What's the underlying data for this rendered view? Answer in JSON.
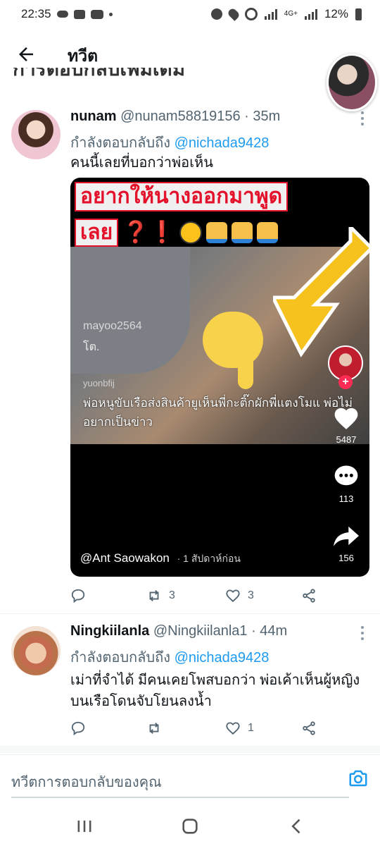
{
  "status_bar": {
    "time": "22:35",
    "network": "4G+",
    "battery": "12%"
  },
  "header": {
    "title": "ทวีต"
  },
  "cut_text": "การตอบกลับเพิ่มเติม",
  "tweets": [
    {
      "name": "nunam",
      "handle": "@nunam58819156",
      "time": "· 35m",
      "replying_label": "กำลังตอบกลับถึง",
      "replying_to": "@nichada9428",
      "text": "คนนี้เลยที่บอกว่าพ่อเห็น",
      "media": {
        "banner_line1": "อยากให้นางออกมาพูด",
        "banner_line2": "เลย",
        "banner_marks": "❓❗",
        "watermark_user": "mayoo2564",
        "watermark_tag": "โต.",
        "watermark_small": "yuonbfij",
        "subtitle": "พ่อหนูขับเรือส่งสินค้ายูเห็นพี่กะติ๊กผักพี่แตงโมแ พ่อไม่อยากเป็นข่าว",
        "likes": "5487",
        "comments": "113",
        "shares": "156",
        "author": "@Ant Saowakon",
        "posted": "· 1 สัปดาห์ก่อน"
      },
      "replies": "",
      "retweets": "3",
      "likes": "3"
    },
    {
      "name": "Ningkiilanla",
      "handle": "@Ningkiilanla1",
      "time": "· 44m",
      "replying_label": "กำลังตอบกลับถึง",
      "replying_to": "@nichada9428",
      "text": "เม่าที่จำได้ มีคนเคยโพสบอกว่า พ่อเค้าเห็นผู้หญิงบนเรือโดนจับโยนลงน้ำ",
      "replies": "",
      "retweets": "",
      "likes": "1"
    }
  ],
  "composer": {
    "placeholder": "ทวีตการตอบกลับของคุณ"
  },
  "colors": {
    "link": "#1d9bf0",
    "text": "#0f1419",
    "muted": "#536471",
    "banner_red": "#e4112a"
  }
}
